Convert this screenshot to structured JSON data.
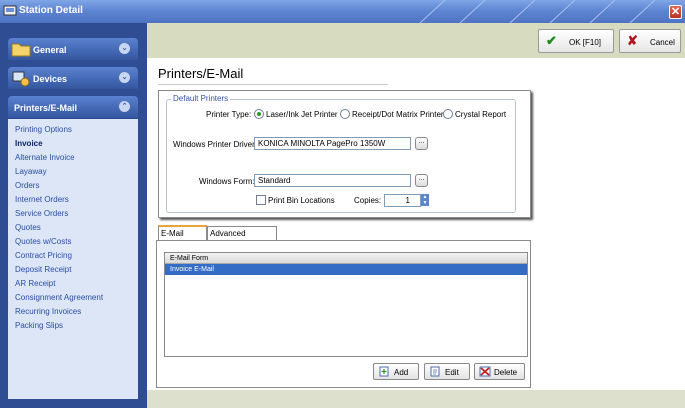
{
  "window": {
    "title": "Station Detail",
    "close_glyph": "✕",
    "title_icon": "station-icon"
  },
  "sidebar": {
    "groups": [
      {
        "label": "General",
        "icon": "folder-icon",
        "chevron": "⌄"
      },
      {
        "label": "Devices",
        "icon": "devices-icon",
        "chevron": "⌄"
      },
      {
        "label": "Printers/E-Mail",
        "chevron": "⌃"
      }
    ],
    "items": [
      "Printing Options",
      "Invoice",
      "Alternate Invoice",
      "Layaway",
      "Orders",
      "Internet Orders",
      "Service Orders",
      "Quotes",
      "Quotes w/Costs",
      "Contract Pricing",
      "Deposit Receipt",
      "AR Receipt",
      "Consignment Agreement",
      "Recurring Invoices",
      "Packing Slips"
    ],
    "active_item": "Invoice"
  },
  "toolbar": {
    "ok_label": "OK [F10]",
    "ok_icon": "✔",
    "cancel_label": "Cancel",
    "cancel_icon": "✘"
  },
  "page_title": "Printers/E-Mail",
  "default_printers": {
    "legend": "Default Printers",
    "printer_type_label": "Printer Type:",
    "printer_type_options": [
      "Laser/Ink Jet Printer",
      "Receipt/Dot Matrix Printer",
      "Crystal Report"
    ],
    "printer_type_selected": "Laser/Ink Jet Printer",
    "driver_label": "Windows Printer Driver:",
    "driver_value": "KONICA MINOLTA PagePro 1350W",
    "form_label": "Windows Form:",
    "form_value": "Standard",
    "ellipsis": "...",
    "print_bin_label": "Print Bin Locations",
    "print_bin_checked": false,
    "copies_label": "Copies:",
    "copies_value": "1"
  },
  "tabs": [
    {
      "label": "E-Mail Forms",
      "active": true
    },
    {
      "label": "Advanced Printing",
      "active": false
    }
  ],
  "email_forms": {
    "column_header": "E-Mail Form",
    "rows": [
      "Invoice E-Mail"
    ],
    "selected": "Invoice E-Mail"
  },
  "actions": {
    "add_label": "Add",
    "edit_label": "Edit",
    "delete_label": "Delete"
  },
  "colors": {
    "title_bar": "#5f86d3",
    "sidebar": "#2f4d92",
    "nav_panel": "#dde6f7",
    "toolbar": "#d7dbbf",
    "selection": "#336cc4",
    "active_tab_accent": "#e8a33d"
  }
}
